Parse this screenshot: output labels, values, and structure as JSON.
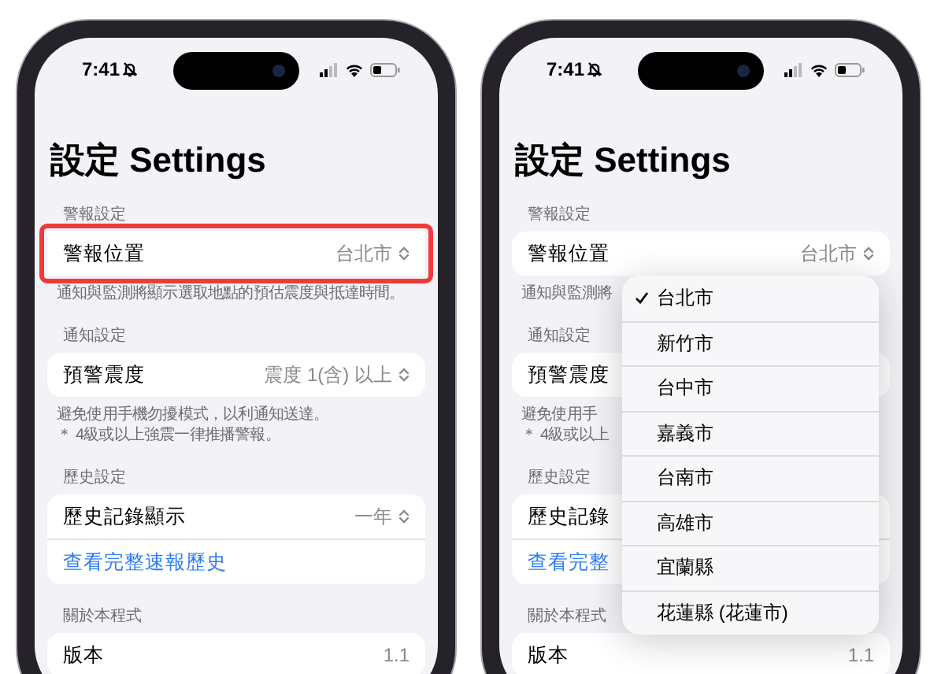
{
  "phones": [
    {
      "time": "7:41",
      "title": "設定 Settings",
      "sections": [
        {
          "header": "警報設定",
          "rows": [
            {
              "kind": "picker",
              "label": "警報位置",
              "value": "台北市",
              "highlighted": true
            }
          ],
          "footer": [
            "通知與監測將顯示選取地點的預估震度與抵達時間。"
          ]
        },
        {
          "header": "通知設定",
          "rows": [
            {
              "kind": "picker",
              "label": "預警震度",
              "value": "震度 1(含) 以上",
              "highlighted": false
            }
          ],
          "footer": [
            "避免使用手機勿擾模式，以利通知送達。",
            "＊ 4級或以上強震一律推播警報。"
          ]
        },
        {
          "header": "歷史設定",
          "rows": [
            {
              "kind": "picker",
              "label": "歷史記錄顯示",
              "value": "一年",
              "highlighted": false
            },
            {
              "kind": "link",
              "label": "查看完整速報歷史",
              "highlighted": false
            }
          ]
        },
        {
          "header": "關於本程式",
          "rows": [
            {
              "kind": "info",
              "label": "版本",
              "value": "1.1",
              "highlighted": false
            }
          ]
        }
      ]
    },
    {
      "time": "7:41",
      "title": "設定 Settings",
      "sections": [
        {
          "header": "警報設定",
          "rows": [
            {
              "kind": "picker",
              "label": "警報位置",
              "value": "台北市",
              "highlighted": false
            }
          ],
          "footer": [
            "通知與監測將"
          ]
        },
        {
          "header": "通知設定",
          "rows": [
            {
              "kind": "picker",
              "label": "預警震度",
              "highlighted": false
            }
          ],
          "footer": [
            "避免使用手",
            "＊ 4級或以上"
          ]
        },
        {
          "header": "歷史設定",
          "rows": [
            {
              "kind": "picker",
              "label": "歷史記錄",
              "highlighted": false
            },
            {
              "kind": "link",
              "label": "查看完整",
              "highlighted": false
            }
          ]
        },
        {
          "header": "關於本程式",
          "rows": [
            {
              "kind": "info",
              "label": "版本",
              "value": "1.1",
              "highlighted": false
            }
          ]
        }
      ],
      "menu": {
        "items": [
          {
            "label": "台北市",
            "selected": true
          },
          {
            "label": "新竹市",
            "selected": false
          },
          {
            "label": "台中市",
            "selected": false
          },
          {
            "label": "嘉義市",
            "selected": false
          },
          {
            "label": "台南市",
            "selected": false
          },
          {
            "label": "高雄市",
            "selected": false
          },
          {
            "label": "宜蘭縣",
            "selected": false
          },
          {
            "label": "花蓮縣 (花蓮市)",
            "selected": false
          }
        ]
      }
    }
  ]
}
